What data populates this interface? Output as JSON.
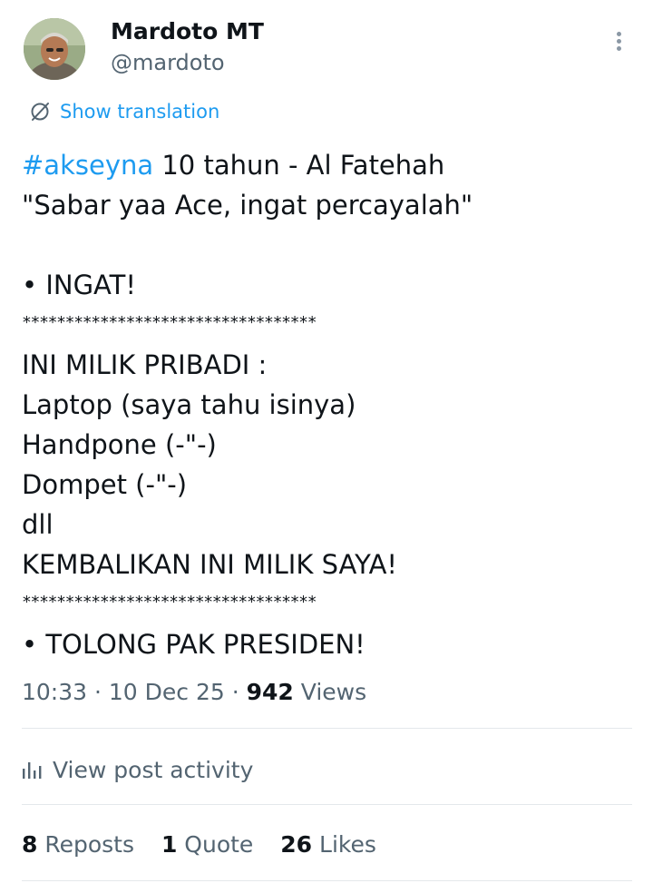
{
  "author": {
    "name": "Mardoto MT",
    "handle": "@mardoto"
  },
  "translate": {
    "label": "Show translation"
  },
  "post": {
    "hashtag": "#akseyna",
    "line1_rest": " 10 tahun - Al Fatehah",
    "line2": "\"Sabar yaa Ace, ingat percayalah\"",
    "line3": "• INGAT!",
    "stars1": "**********************************",
    "line4": "INI MILIK PRIBADI :",
    "line5": "Laptop (saya tahu isinya)",
    "line6": "Handpone (-\"-)",
    "line7": "Dompet (-\"-)",
    "line8": "dll",
    "line9": "KEMBALIKAN INI MILIK SAYA!",
    "stars2": "**********************************",
    "line10": "• TOLONG PAK PRESIDEN!"
  },
  "meta": {
    "time": "10:33",
    "sep1": " · ",
    "date": "10 Dec 25",
    "sep2": " · ",
    "views_count": "942",
    "views_label": " Views"
  },
  "activity": {
    "label": "View post activity"
  },
  "stats": {
    "reposts_count": "8",
    "reposts_label": " Reposts",
    "quotes_count": "1",
    "quotes_label": " Quote",
    "likes_count": "26",
    "likes_label": " Likes"
  },
  "colors": {
    "accent": "#1d9bf0",
    "text": "#0f1419",
    "secondary": "#536471",
    "divider": "#e4e8eb"
  },
  "icons": {
    "translate": "translate-icon",
    "more": "more-options-icon",
    "activity": "bar-chart-icon"
  }
}
